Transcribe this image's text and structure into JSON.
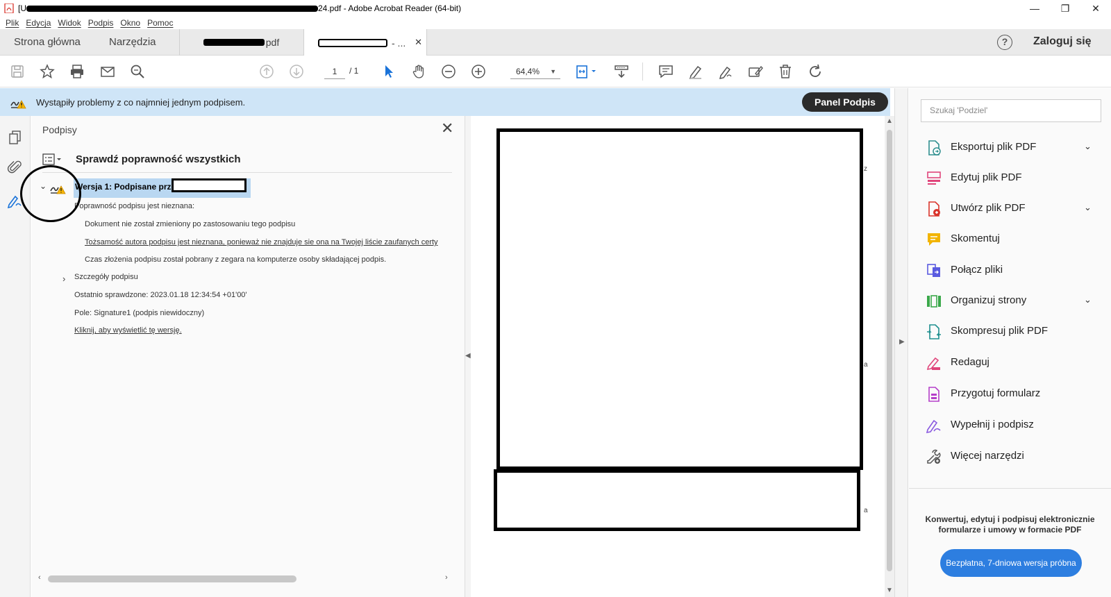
{
  "window": {
    "title_prefix": "[U",
    "title_suffix": "24.pdf - Adobe Acrobat Reader (64-bit)",
    "minimize": "—",
    "maximize": "❐",
    "close": "✕"
  },
  "menu": [
    "Plik",
    "Edycja",
    "Widok",
    "Podpis",
    "Okno",
    "Pomoc"
  ],
  "tabs": {
    "home": "Strona główna",
    "tools": "Narzędzia",
    "doc1_suffix": "pdf",
    "doc2_suffix": "- ...",
    "close": "✕"
  },
  "account": {
    "help": "?",
    "signin": "Zaloguj się"
  },
  "toolbar": {
    "page_current": "1",
    "page_total": "/ 1",
    "zoom": "64,4%",
    "zoom_caret": "▼"
  },
  "notification": {
    "message": "Wystąpiły problemy z co najmniej jednym podpisem.",
    "panel_button": "Panel Podpis"
  },
  "signatures": {
    "title": "Podpisy",
    "close": "✕",
    "validate_all": "Sprawdź poprawność wszystkich",
    "version_label": "Wersja 1: Podpisane przez",
    "validity_unknown": "Poprawność podpisu jest nieznana:",
    "doc_unchanged": "Dokument nie został zmieniony po zastosowaniu tego podpisu",
    "identity_unknown": "Tożsamość autora podpisu jest nieznana, ponieważ nie znajduje sie ona na Twojej liście zaufanych certy",
    "time_source": "Czas złożenia podpisu został pobrany z zegara na komputerze osoby składającej podpis.",
    "details": "Szczegóły podpisu",
    "last_checked": "Ostatnio sprawdzone: 2023.01.18 12:34:54 +01'00'",
    "field": "Pole: Signature1 (podpis niewidoczny)",
    "view_version": "Kliknij, aby wyświetlić tę wersję."
  },
  "document": {
    "mark1": "z",
    "mark2": "a",
    "mark3": "a"
  },
  "tools": {
    "search_placeholder": "Szukaj 'Podziel'",
    "items": [
      {
        "label": "Eksportuj plik PDF",
        "color": "#2f8f8f",
        "chevron": "⌄"
      },
      {
        "label": "Edytuj plik PDF",
        "color": "#e0457b",
        "chevron": ""
      },
      {
        "label": "Utwórz plik PDF",
        "color": "#d9342b",
        "chevron": "⌄"
      },
      {
        "label": "Skomentuj",
        "color": "#f2b400",
        "chevron": ""
      },
      {
        "label": "Połącz pliki",
        "color": "#5a5be0",
        "chevron": ""
      },
      {
        "label": "Organizuj strony",
        "color": "#3aa84a",
        "chevron": "⌄"
      },
      {
        "label": "Skompresuj plik PDF",
        "color": "#1e8f8f",
        "chevron": ""
      },
      {
        "label": "Redaguj",
        "color": "#e0457b",
        "chevron": ""
      },
      {
        "label": "Przygotuj formularz",
        "color": "#b53fc9",
        "chevron": ""
      },
      {
        "label": "Wypełnij i podpisz",
        "color": "#8a5ae0",
        "chevron": ""
      },
      {
        "label": "Więcej narzędzi",
        "color": "#555555",
        "chevron": ""
      }
    ],
    "promo": "Konwertuj, edytuj i podpisuj elektronicznie formularze i umowy w formacie PDF",
    "trial_button": "Bezpłatna, 7-dniowa wersja próbna"
  }
}
